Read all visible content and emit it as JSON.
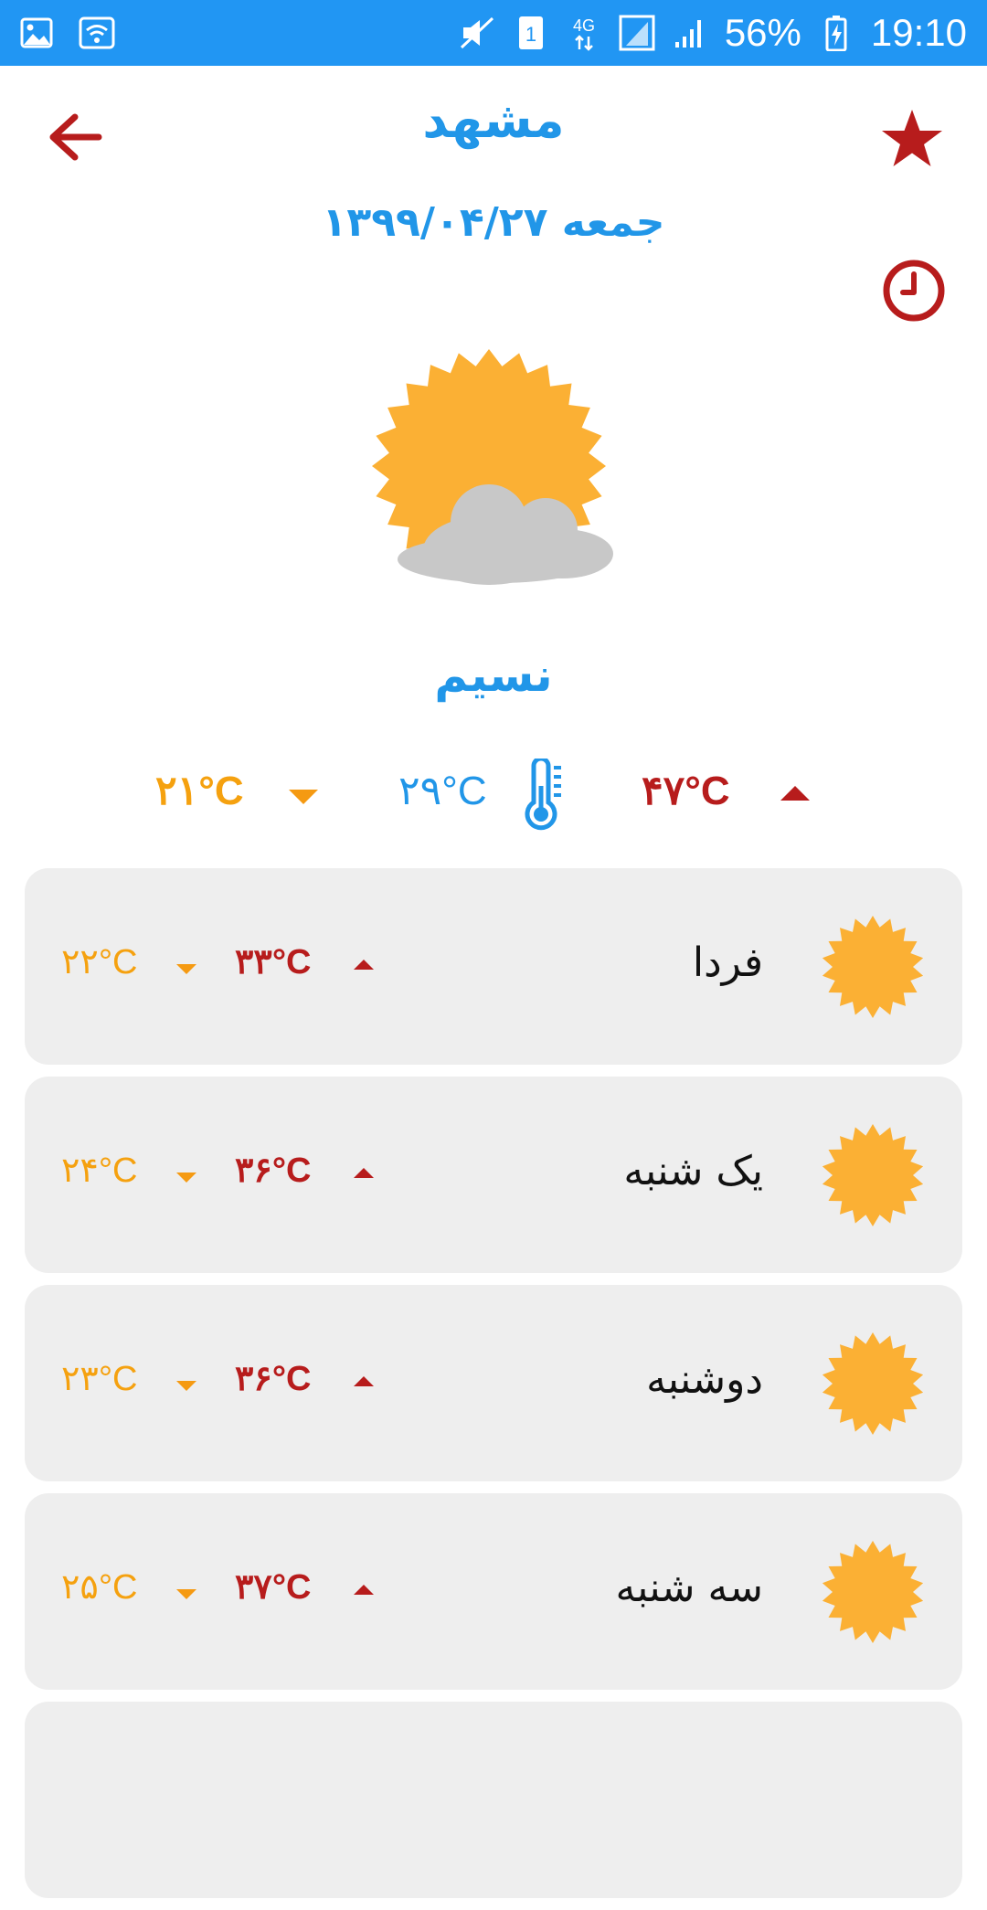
{
  "status_bar": {
    "battery": "56%",
    "time": "19:10",
    "network": "4G",
    "sim": "1",
    "icons": [
      "image-icon",
      "wifi-icon",
      "mute-vibrate-icon",
      "sim-icon",
      "network-icon",
      "signal-icon",
      "signal-icon",
      "battery-charging-icon"
    ]
  },
  "header": {
    "city": "مشهد",
    "date": "جمعه ۱۳۹۹/۰۴/۲۷",
    "back_icon": "arrow-left-icon",
    "favorite_icon": "star-icon",
    "history_icon": "clock-icon"
  },
  "current": {
    "icon": "partly-cloudy-icon",
    "condition": "نسیم",
    "max": "۴۷°C",
    "current": "۲۹°C",
    "min": "۲۱°C"
  },
  "forecast": [
    {
      "day": "فردا",
      "max": "۳۳°C",
      "min": "۲۲°C",
      "icon": "sun-icon"
    },
    {
      "day": "یک شنبه",
      "max": "۳۶°C",
      "min": "۲۴°C",
      "icon": "sun-icon"
    },
    {
      "day": "دوشنبه",
      "max": "۳۶°C",
      "min": "۲۳°C",
      "icon": "sun-icon"
    },
    {
      "day": "سه شنبه",
      "max": "۳۷°C",
      "min": "۲۵°C",
      "icon": "sun-icon"
    }
  ],
  "colors": {
    "status_bar": "#2196f3",
    "accent_blue": "#2196e8",
    "max_red": "#b71c1c",
    "min_orange": "#f5a10f",
    "sun": "#fbb034",
    "card": "#eeeeee"
  }
}
